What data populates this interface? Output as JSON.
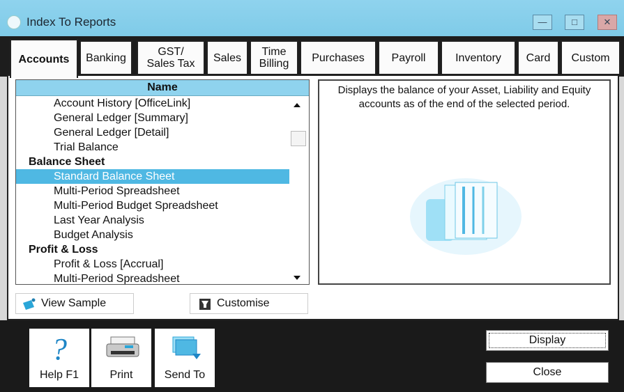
{
  "window": {
    "title": "Index To Reports",
    "buttons": [
      "minimize",
      "maximize",
      "close"
    ]
  },
  "tabs": [
    {
      "label": "Accounts",
      "active": true
    },
    {
      "label": "Banking"
    },
    {
      "label": "GST/\nSales Tax"
    },
    {
      "label": "Sales"
    },
    {
      "label": "Time\nBilling"
    },
    {
      "label": "Purchases"
    },
    {
      "label": "Payroll"
    },
    {
      "label": "Inventory"
    },
    {
      "label": "Card"
    },
    {
      "label": "Custom"
    }
  ],
  "report_list": {
    "header": "Name",
    "rows": [
      {
        "text": "Account History [OfficeLink]",
        "kind": "item"
      },
      {
        "text": "General Ledger [Summary]",
        "kind": "item"
      },
      {
        "text": "General Ledger [Detail]",
        "kind": "item"
      },
      {
        "text": "Trial Balance",
        "kind": "item"
      },
      {
        "text": "Balance Sheet",
        "kind": "section"
      },
      {
        "text": "Standard Balance Sheet",
        "kind": "item",
        "selected": true
      },
      {
        "text": "Multi-Period Spreadsheet",
        "kind": "item"
      },
      {
        "text": "Multi-Period Budget Spreadsheet",
        "kind": "item"
      },
      {
        "text": "Last Year Analysis",
        "kind": "item"
      },
      {
        "text": "Budget Analysis",
        "kind": "item"
      },
      {
        "text": "Profit & Loss",
        "kind": "section"
      },
      {
        "text": "Profit & Loss [Accrual]",
        "kind": "item"
      },
      {
        "text": "Multi-Period Spreadsheet",
        "kind": "item"
      }
    ]
  },
  "description": "Displays the balance of your Asset, Liability and Equity accounts as of the end of the selected period.",
  "buttons": {
    "view_sample": "View Sample",
    "customise": "Customise",
    "help": "Help F1",
    "print": "Print",
    "send_to": "Send To",
    "display": "Display",
    "close": "Close"
  },
  "colors": {
    "title_bar": "#8fd3ee",
    "selection": "#4fb8e3",
    "header": "#8fd3ee"
  }
}
